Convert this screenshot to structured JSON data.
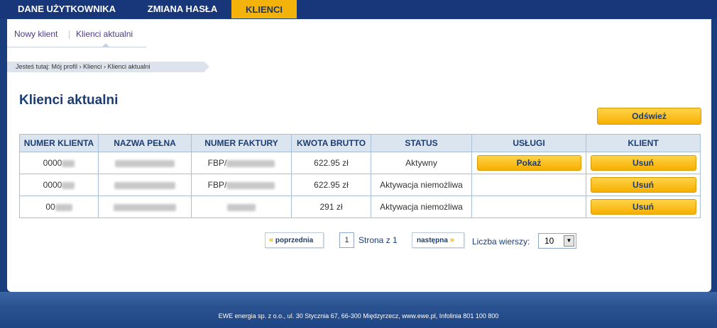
{
  "topnav": {
    "tabs": [
      {
        "label": "DANE UŻYTKOWNIKA"
      },
      {
        "label": "ZMIANA HASŁA"
      },
      {
        "label": "KLIENCI"
      }
    ]
  },
  "subnav": {
    "items": [
      {
        "label": "Nowy klient"
      },
      {
        "label": "Klienci aktualni"
      }
    ]
  },
  "breadcrumb": "Jesteś tutaj: Mój profil › Klienci › Klienci aktualni",
  "page_title": "Klienci aktualni",
  "refresh_label": "Odśwież",
  "table": {
    "headers": [
      "NUMER KLIENTA",
      "NAZWA PEŁNA",
      "NUMER FAKTURY",
      "KWOTA BRUTTO",
      "STATUS",
      "USŁUGI",
      "KLIENT"
    ],
    "rows": [
      {
        "client_no": "0000",
        "invoice": "FBP/",
        "amount": "622.95 zł",
        "status": "Aktywny",
        "services_label": "Pokaż",
        "action_label": "Usuń"
      },
      {
        "client_no": "0000",
        "invoice": "FBP/",
        "amount": "622.95 zł",
        "status": "Aktywacja niemożliwa",
        "services_label": "",
        "action_label": "Usuń"
      },
      {
        "client_no": "00",
        "invoice": "",
        "amount": "291 zł",
        "status": "Aktywacja niemożliwa",
        "services_label": "",
        "action_label": "Usuń"
      }
    ]
  },
  "pager": {
    "prev_label": "poprzednia",
    "page": "1",
    "page_of": "Strona z 1",
    "next_label": "następna",
    "rows_label": "Liczba wierszy:",
    "rows_value": "10"
  },
  "footer": "EWE energia sp. z o.o., ul. 30 Stycznia 67, 66-300 Międzyrzecz, www.ewe.pl, Infolinia 801 100 800",
  "colors": {
    "navy": "#17377a",
    "accent_yellow": "#f4b30a",
    "title_blue": "#1c3d73"
  }
}
